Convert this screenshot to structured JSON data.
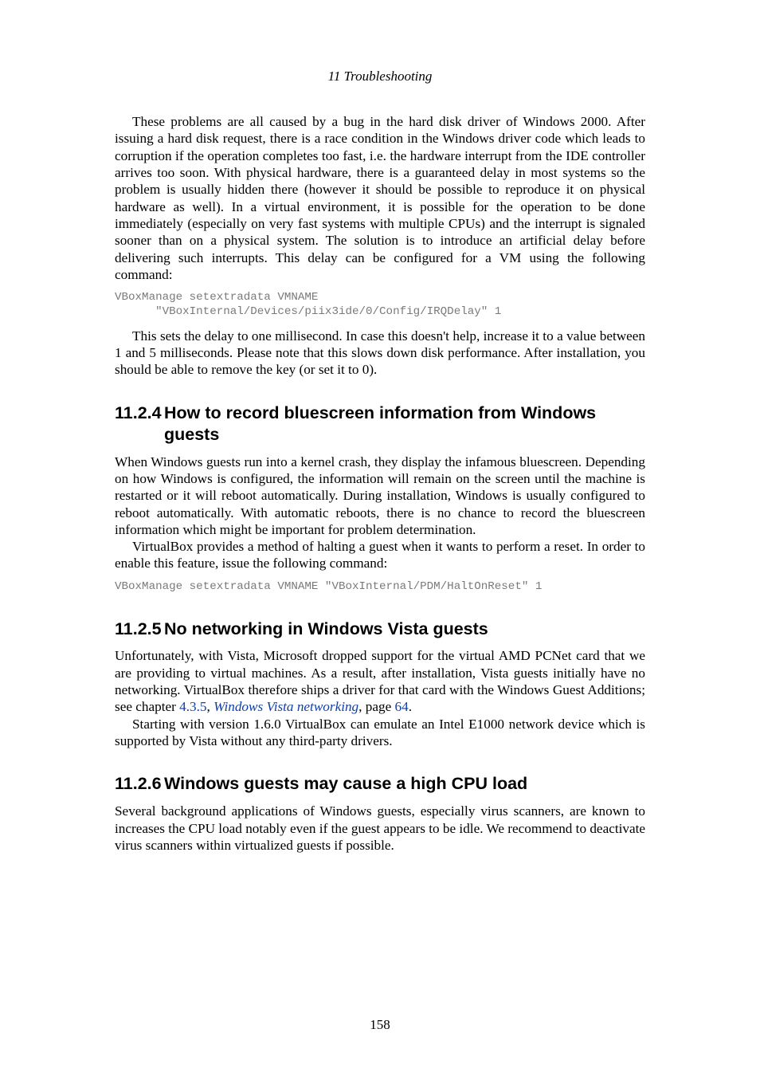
{
  "running_head": "11 Troubleshooting",
  "p1": "These problems are all caused by a bug in the hard disk driver of Windows 2000. After issuing a hard disk request, there is a race condition in the Windows driver code which leads to corruption if the operation completes too fast, i.e. the hardware interrupt from the IDE controller arrives too soon. With physical hardware, there is a guaranteed delay in most systems so the problem is usually hidden there (however it should be possible to reproduce it on physical hardware as well). In a virtual environment, it is possible for the operation to be done immediately (especially on very fast systems with multiple CPUs) and the interrupt is signaled sooner than on a physical system. The solution is to introduce an artificial delay before delivering such interrupts. This delay can be configured for a VM using the following command:",
  "code1": "VBoxManage setextradata VMNAME\n      \"VBoxInternal/Devices/piix3ide/0/Config/IRQDelay\" 1",
  "p2": "This sets the delay to one millisecond. In case this doesn't help, increase it to a value between 1 and 5 milliseconds. Please note that this slows down disk performance. After installation, you should be able to remove the key (or set it to 0).",
  "sec_11_2_4_num": "11.2.4",
  "sec_11_2_4_title": "How to record bluescreen information from Windows guests",
  "p3": "When Windows guests run into a kernel crash, they display the infamous bluescreen. Depending on how Windows is configured, the information will remain on the screen until the machine is restarted or it will reboot automatically. During installation, Windows is usually configured to reboot automatically. With automatic reboots, there is no chance to record the bluescreen information which might be important for problem determination.",
  "p4": "VirtualBox provides a method of halting a guest when it wants to perform a reset. In order to enable this feature, issue the following command:",
  "code2": "VBoxManage setextradata VMNAME \"VBoxInternal/PDM/HaltOnReset\" 1",
  "sec_11_2_5_num": "11.2.5",
  "sec_11_2_5_title": "No networking in Windows Vista guests",
  "p5a": "Unfortunately, with Vista, Microsoft dropped support for the virtual AMD PCNet card that we are providing to virtual machines. As a result, after installation, Vista guests initially have no networking. VirtualBox therefore ships a driver for that card with the Windows Guest Additions; see chapter ",
  "link_435": "4.3.5",
  "p5b": ", ",
  "link_wvn": "Windows Vista networking",
  "p5c": ", page ",
  "link_64": "64",
  "p5d": ".",
  "p6": "Starting with version 1.6.0 VirtualBox can emulate an Intel E1000 network device which is supported by Vista without any third-party drivers.",
  "sec_11_2_6_num": "11.2.6",
  "sec_11_2_6_title": "Windows guests may cause a high CPU load",
  "p7": "Several background applications of Windows guests, especially virus scanners, are known to increases the CPU load notably even if the guest appears to be idle. We recommend to deactivate virus scanners within virtualized guests if possible.",
  "page_number": "158"
}
